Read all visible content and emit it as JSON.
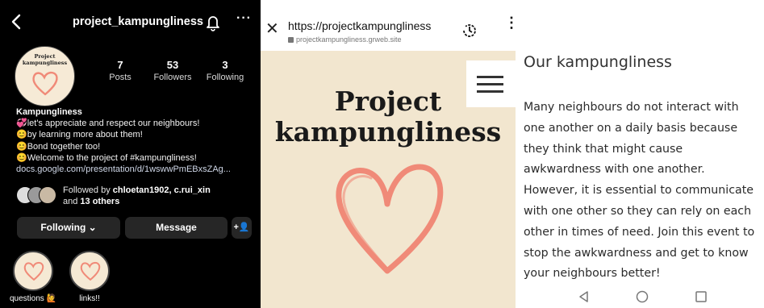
{
  "instagram": {
    "username": "project_kampungliness",
    "avatar_title": "Project kampungliness",
    "stats": [
      {
        "count": "7",
        "label": "Posts"
      },
      {
        "count": "53",
        "label": "Followers"
      },
      {
        "count": "3",
        "label": "Following"
      }
    ],
    "bio": {
      "name": "Kampungliness",
      "lines": [
        "💞let's appreciate and respect our neighbours!",
        "😊by learning more about them!",
        "😊Bond together too!",
        "😊Welcome to the project of #kampungliness!"
      ],
      "link": "docs.google.com/presentation/d/1wswwPmEBxsZAg..."
    },
    "followed_by": {
      "prefix": "Followed by ",
      "names": "chloetan1902, c.rui_xin",
      "suffix_and": "and ",
      "others": "13 others"
    },
    "buttons": {
      "following": "Following ⌄",
      "message": "Message",
      "add_person": "+👤"
    },
    "highlights": [
      {
        "label": "questions 🙋"
      },
      {
        "label": "links!!"
      }
    ],
    "icons": {
      "back": "chevron-left-icon",
      "bell": "bell-icon",
      "more": "more-icon"
    }
  },
  "browser": {
    "url": "https://projectkampungliness",
    "subdomain": "projectkampungliness.grweb.site",
    "close_symbol": "✕",
    "menu_symbol": "⋮",
    "page_title_line1": "Project",
    "page_title_line2": "kampungliness",
    "heart_color": "#f08a78",
    "background": "#f2e6cf"
  },
  "article": {
    "heading": "Our kampungliness",
    "body": "Many neighbours do not interact with one another on a daily basis because they think that might cause awkwardness with one another. However, it is essential to communicate with one other so they can rely on each other in times of need. Join this event to stop the awkwardness and get to know your neighbours better!",
    "nav_icons": [
      "back-triangle-icon",
      "home-circle-icon",
      "recents-square-icon"
    ]
  }
}
